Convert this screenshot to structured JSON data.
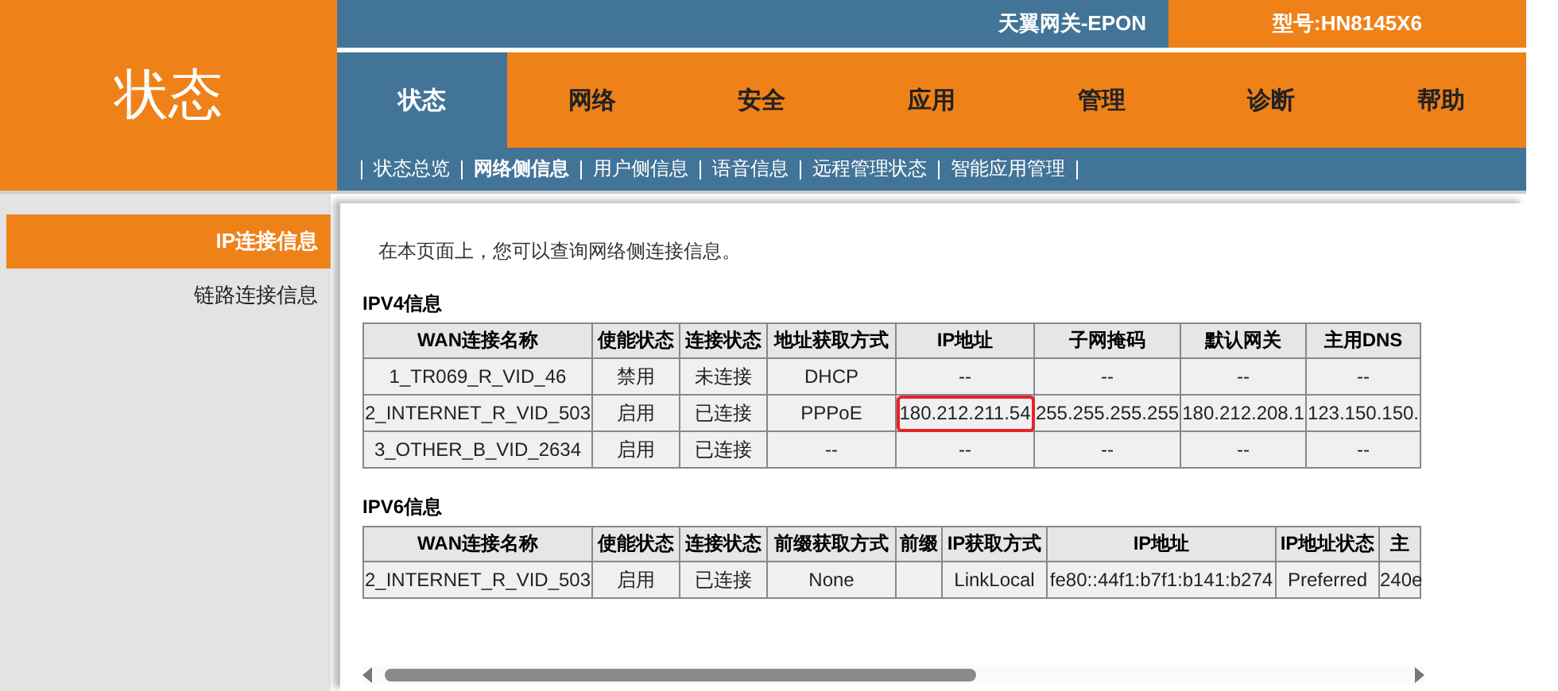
{
  "header": {
    "section_title": "状态",
    "brand": "天翼网关-EPON",
    "model": "型号:HN8145X6"
  },
  "main_tabs": [
    {
      "label": "状态",
      "selected": true
    },
    {
      "label": "网络",
      "selected": false
    },
    {
      "label": "安全",
      "selected": false
    },
    {
      "label": "应用",
      "selected": false
    },
    {
      "label": "管理",
      "selected": false
    },
    {
      "label": "诊断",
      "selected": false
    },
    {
      "label": "帮助",
      "selected": false
    }
  ],
  "sub_tabs": [
    {
      "label": "状态总览",
      "selected": false
    },
    {
      "label": "网络侧信息",
      "selected": true
    },
    {
      "label": "用户侧信息",
      "selected": false
    },
    {
      "label": "语音信息",
      "selected": false
    },
    {
      "label": "远程管理状态",
      "selected": false
    },
    {
      "label": "智能应用管理",
      "selected": false
    }
  ],
  "sidebar": {
    "items": [
      {
        "label": "IP连接信息",
        "selected": true
      },
      {
        "label": "链路连接信息",
        "selected": false
      }
    ]
  },
  "intro": "在本页面上，您可以查询网络侧连接信息。",
  "tables": [
    {
      "title": "IPV4信息",
      "columns": [
        "WAN连接名称",
        "使能状态",
        "连接状态",
        "地址获取方式",
        "IP地址",
        "子网掩码",
        "默认网关",
        "主用DNS"
      ],
      "rows": [
        {
          "cells": [
            "1_TR069_R_VID_46",
            "禁用",
            "未连接",
            "DHCP",
            "--",
            "--",
            "--",
            "--"
          ],
          "highlighted": [
            false,
            false,
            false,
            false,
            false,
            false,
            false,
            false
          ]
        },
        {
          "cells": [
            "2_INTERNET_R_VID_503",
            "启用",
            "已连接",
            "PPPoE",
            "180.212.211.54",
            "255.255.255.255",
            "180.212.208.1",
            "123.150.150."
          ],
          "highlighted": [
            false,
            false,
            false,
            false,
            true,
            false,
            false,
            false
          ]
        },
        {
          "cells": [
            "3_OTHER_B_VID_2634",
            "启用",
            "已连接",
            "--",
            "--",
            "--",
            "--",
            "--"
          ],
          "highlighted": [
            false,
            false,
            false,
            false,
            false,
            false,
            false,
            false
          ]
        }
      ]
    },
    {
      "title": "IPV6信息",
      "columns": [
        "WAN连接名称",
        "使能状态",
        "连接状态",
        "前缀获取方式",
        "前缀",
        "IP获取方式",
        "IP地址",
        "IP地址状态",
        "主"
      ],
      "rows": [
        {
          "cells": [
            "2_INTERNET_R_VID_503",
            "启用",
            "已连接",
            "None",
            "",
            "LinkLocal",
            "fe80::44f1:b7f1:b141:b274",
            "Preferred",
            "240e"
          ],
          "highlighted": [
            false,
            false,
            false,
            false,
            false,
            false,
            false,
            false,
            false
          ]
        }
      ]
    }
  ]
}
